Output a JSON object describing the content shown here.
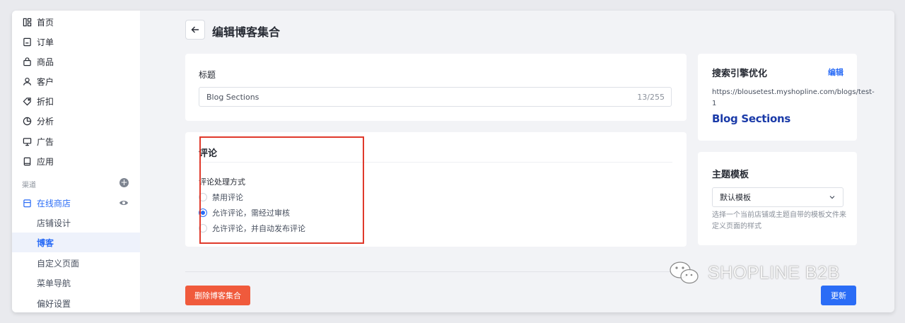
{
  "sidebar": {
    "items": [
      {
        "label": "首页",
        "icon": "dashboard-icon"
      },
      {
        "label": "订单",
        "icon": "order-icon"
      },
      {
        "label": "商品",
        "icon": "bag-icon"
      },
      {
        "label": "客户",
        "icon": "person-icon"
      },
      {
        "label": "折扣",
        "icon": "tag-icon"
      },
      {
        "label": "分析",
        "icon": "pie-chart-icon"
      },
      {
        "label": "广告",
        "icon": "monitor-icon"
      },
      {
        "label": "应用",
        "icon": "tablet-icon"
      }
    ],
    "channels_label": "渠道",
    "online_store": {
      "label": "在线商店",
      "icon": "store-icon"
    },
    "sub_items": [
      {
        "label": "店铺设计"
      },
      {
        "label": "博客"
      },
      {
        "label": "自定义页面"
      },
      {
        "label": "菜单导航"
      },
      {
        "label": "偏好设置"
      }
    ]
  },
  "header": {
    "title": "编辑博客集合"
  },
  "title_card": {
    "label": "标题",
    "input_value": "Blog Sections",
    "counter": "13/255"
  },
  "comments_card": {
    "title": "评论",
    "subtitle": "评论处理方式",
    "options": [
      {
        "label": "禁用评论",
        "selected": false
      },
      {
        "label": "允许评论，需经过审核",
        "selected": true
      },
      {
        "label": "允许评论，并自动发布评论",
        "selected": false
      }
    ]
  },
  "seo_card": {
    "title": "搜索引擎优化",
    "edit_label": "编辑",
    "url": "https://blousetest.myshopline.com/blogs/test-1",
    "preview_title": "Blog Sections"
  },
  "theme_card": {
    "title": "主题模板",
    "selected": "默认模板",
    "helper": "选择一个当前店铺或主题自带的模板文件来定义页面的样式"
  },
  "actions": {
    "delete_label": "删除博客集合",
    "update_label": "更新"
  },
  "watermark": {
    "text": "SHOPLINE B2B"
  },
  "colors": {
    "accent": "#2a6cf6",
    "danger": "#f05a3c",
    "highlight_border": "#e0392b"
  }
}
